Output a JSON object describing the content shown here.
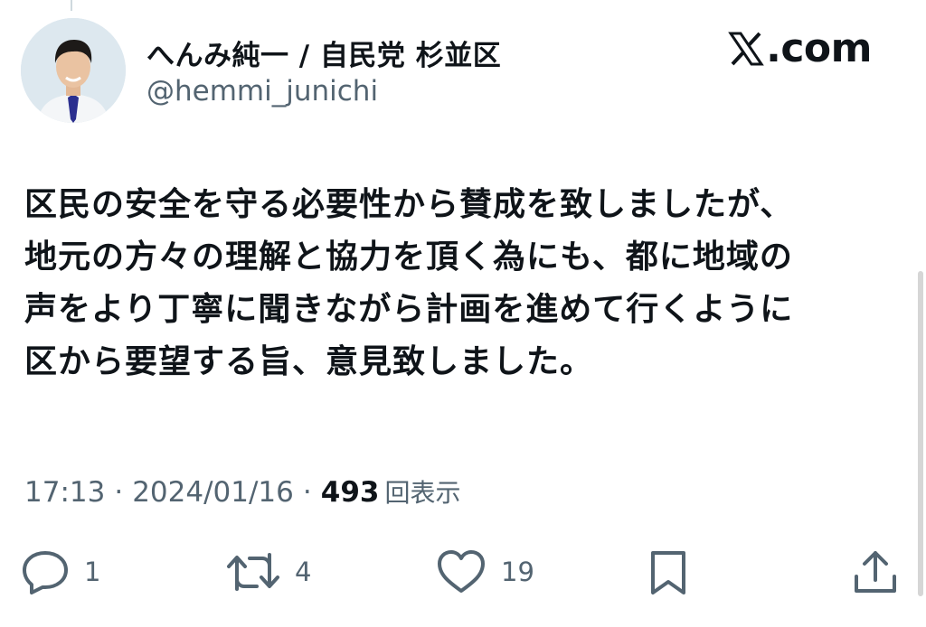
{
  "author": {
    "display_name": "へんみ純一 / 自民党 杉並区",
    "handle": "@hemmi_junichi",
    "avatar": "avatar-photo"
  },
  "brand": {
    "domain": ".com",
    "icon": "x-logo-icon"
  },
  "tweet": {
    "lines": [
      "区民の安全を守る必要性から賛成を致しましたが、",
      "地元の方々の理解と協力を頂く為にも、都に地域の",
      "声をより丁寧に聞きながら計画を進めて行くように",
      "区から要望する旨、意見致しました。"
    ]
  },
  "meta": {
    "time": "17:13",
    "separator": "·",
    "date": "2024/01/16",
    "views": "493",
    "views_label": "回表示"
  },
  "actions": {
    "reply": {
      "icon": "reply-icon",
      "count": "1"
    },
    "retweet": {
      "icon": "retweet-icon",
      "count": "4"
    },
    "like": {
      "icon": "heart-icon",
      "count": "19"
    },
    "bookmark": {
      "icon": "bookmark-icon"
    },
    "share": {
      "icon": "share-icon"
    }
  }
}
